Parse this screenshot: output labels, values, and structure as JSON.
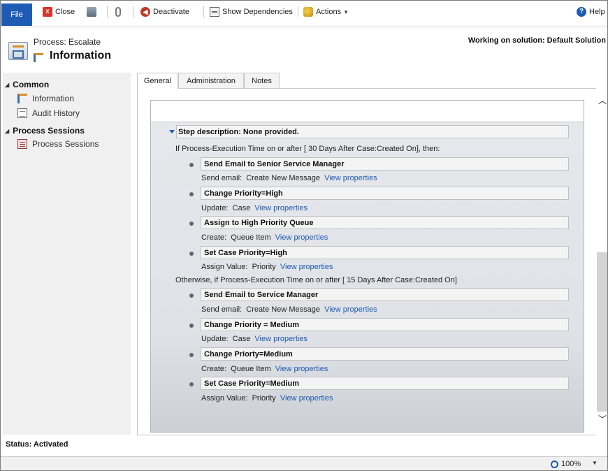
{
  "ribbon": {
    "file": "File",
    "close": "Close",
    "deactivate": "Deactivate",
    "show_dependencies": "Show Dependencies",
    "actions": "Actions",
    "help": "Help"
  },
  "header": {
    "subtitle": "Process: Escalate",
    "title": "Information",
    "solution": "Working on solution: Default Solution"
  },
  "nav": {
    "common": "Common",
    "information": "Information",
    "audit_history": "Audit History",
    "process_sessions_group": "Process Sessions",
    "process_sessions": "Process Sessions"
  },
  "tabs": [
    "General",
    "Administration",
    "Notes"
  ],
  "steps": {
    "description": "Step description: None provided.",
    "condition_if": "If Process-Execution Time on or after [ 30 Days After Case:Created On], then:",
    "condition_otherwise": "Otherwise, if Process-Execution Time on or after [ 15 Days After Case:Created On]",
    "link": "View properties",
    "actions": [
      {
        "title": "Send Email to Senior Service Manager",
        "kind": "Send email:",
        "target": "Create New Message"
      },
      {
        "title": "Change Priority=High",
        "kind": "Update:",
        "target": "Case"
      },
      {
        "title": "Assign to High Priority Queue",
        "kind": "Create:",
        "target": "Queue Item"
      },
      {
        "title": "Set Case Priority=High",
        "kind": "Assign Value:",
        "target": "Priority"
      },
      {
        "title": "Send Email to Service Manager",
        "kind": "Send email:",
        "target": "Create New Message"
      },
      {
        "title": "Change Priority = Medium",
        "kind": "Update:",
        "target": "Case"
      },
      {
        "title": "Change Priorty=Medium",
        "kind": "Create:",
        "target": "Queue Item"
      },
      {
        "title": "Set Case Priority=Medium",
        "kind": "Assign Value:",
        "target": "Priority"
      }
    ]
  },
  "status": "Status: Activated",
  "footer": {
    "zoom": "100%"
  }
}
